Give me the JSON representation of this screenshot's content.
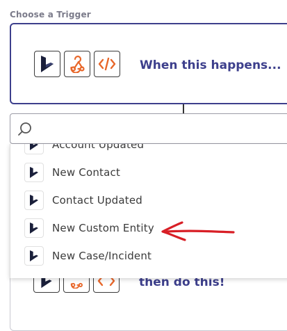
{
  "section_label": "Choose a Trigger",
  "trigger": {
    "title": "When this happens...",
    "icons": [
      "dynamics-icon",
      "webhook-icon",
      "code-icon"
    ]
  },
  "action": {
    "title": "then do this!"
  },
  "search": {
    "placeholder": "",
    "value": ""
  },
  "dropdown": {
    "items": [
      {
        "label": "Account Updated",
        "icon": "dynamics-icon"
      },
      {
        "label": "New Contact",
        "icon": "dynamics-icon"
      },
      {
        "label": "Contact Updated",
        "icon": "dynamics-icon"
      },
      {
        "label": "New Custom Entity",
        "icon": "dynamics-icon"
      },
      {
        "label": "New Case/Incident",
        "icon": "dynamics-icon"
      }
    ]
  },
  "colors": {
    "accent": "#3d3f8c",
    "webhook_orange": "#e8672a",
    "annotation_red": "#d81f26"
  }
}
